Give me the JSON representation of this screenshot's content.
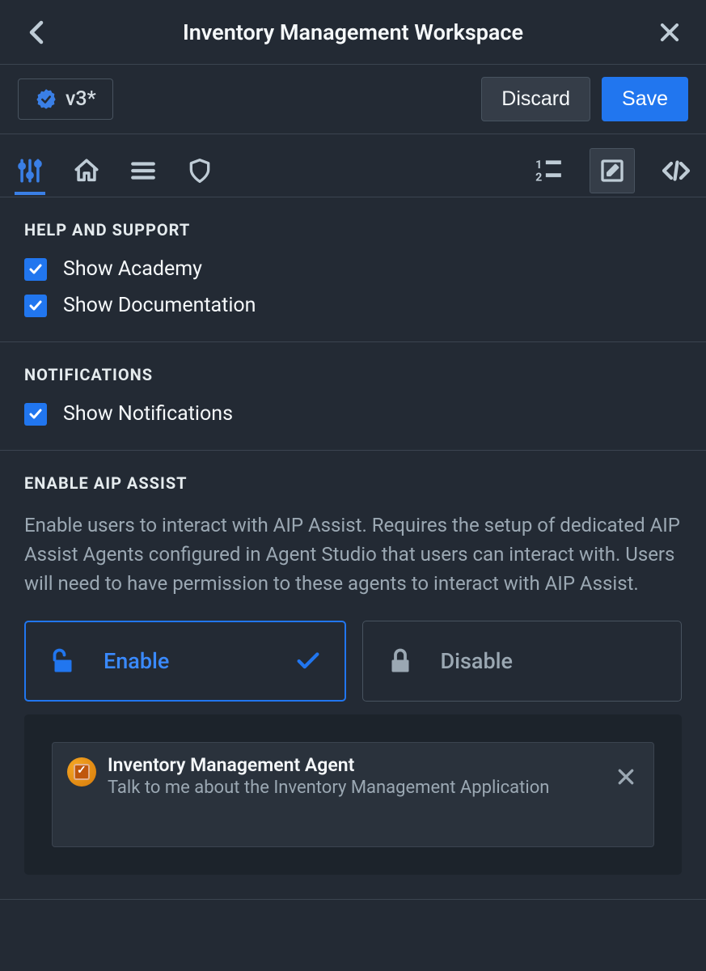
{
  "header": {
    "title": "Inventory Management Workspace"
  },
  "version": {
    "label": "v3*"
  },
  "actions": {
    "discard": "Discard",
    "save": "Save"
  },
  "sections": {
    "help": {
      "title": "HELP AND SUPPORT",
      "items": [
        {
          "label": "Show Academy",
          "checked": true
        },
        {
          "label": "Show Documentation",
          "checked": true
        }
      ]
    },
    "notifications": {
      "title": "NOTIFICATIONS",
      "items": [
        {
          "label": "Show Notifications",
          "checked": true
        }
      ]
    },
    "aip": {
      "title": "ENABLE AIP ASSIST",
      "desc": "Enable users to interact with AIP Assist. Requires the setup of dedicated AIP Assist Agents configured in Agent Studio that users can interact with. Users will need to have permission to these agents to interact with AIP Assist.",
      "enable_label": "Enable",
      "disable_label": "Disable",
      "selected": "enable",
      "agent": {
        "name": "Inventory Management Agent",
        "desc": "Talk to me about the Inventory Management Application"
      }
    }
  }
}
